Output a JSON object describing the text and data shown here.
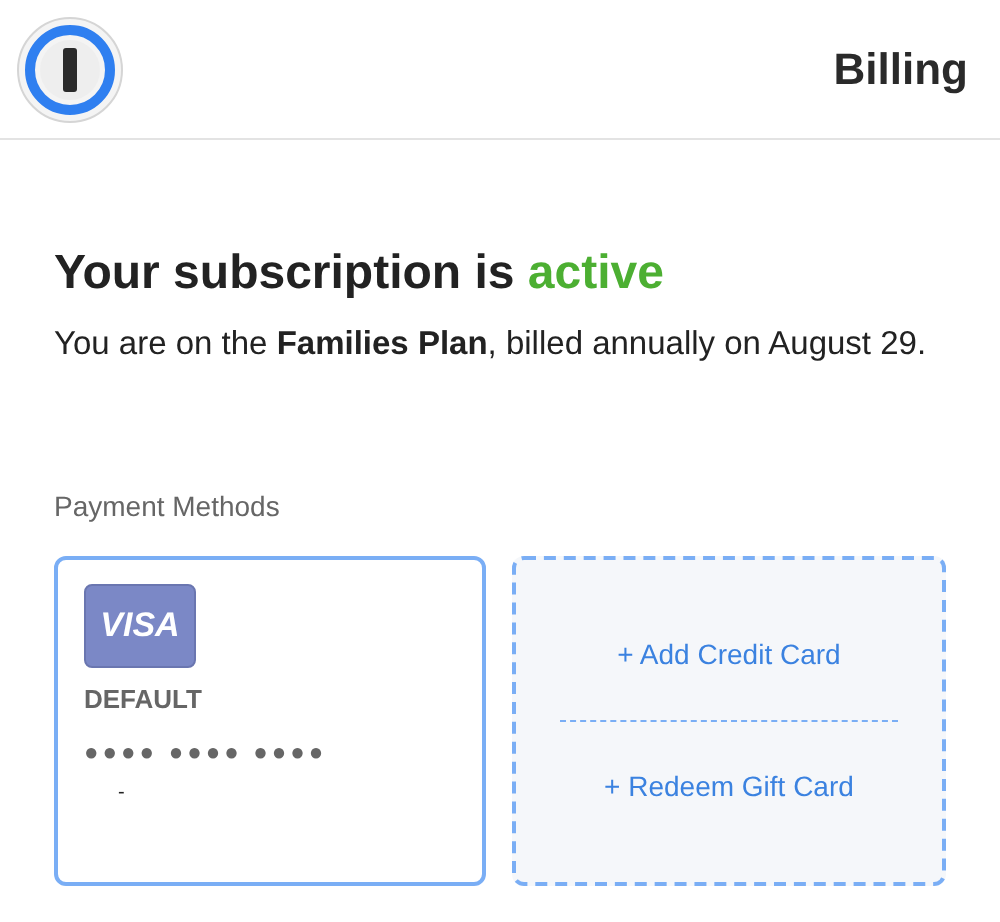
{
  "header": {
    "title": "Billing"
  },
  "subscription": {
    "heading": "Your subscription is ",
    "status": "active",
    "description": "You are on the **Families Plan**, billed annually on August 29."
  },
  "payment_methods": {
    "label": "Payment Methods",
    "card": {
      "brand": "VISA",
      "badge": "DEFAULT",
      "number": "●●●● ●●●● ●●●●",
      "note": "-"
    },
    "actions": [
      "+ Add Credit Card",
      "+ Redeem Gift Card"
    ]
  }
}
